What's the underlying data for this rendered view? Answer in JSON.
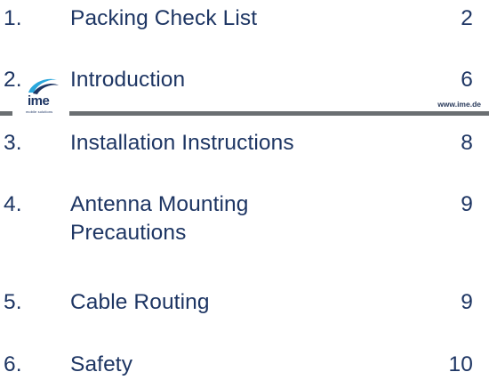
{
  "toc": [
    {
      "num": "1.",
      "title": "Packing Check List",
      "page": "2"
    },
    {
      "num": "2.",
      "title": "Introduction",
      "page": "6"
    },
    {
      "num": "3.",
      "title": "Installation Instructions",
      "page": "8"
    },
    {
      "num": "4.",
      "title": "Antenna Mounting Precautions",
      "page": "9"
    },
    {
      "num": "5.",
      "title": "Cable Routing",
      "page": "9"
    },
    {
      "num": "6.",
      "title": "Safety",
      "page": "10"
    }
  ],
  "logo": {
    "text": "ime",
    "subtext": "mobile solutions"
  },
  "website": "www.ime.de",
  "colors": {
    "text": "#1d3563",
    "rule": "#6b6f72",
    "logo_swoosh": "#2aa7dc"
  }
}
